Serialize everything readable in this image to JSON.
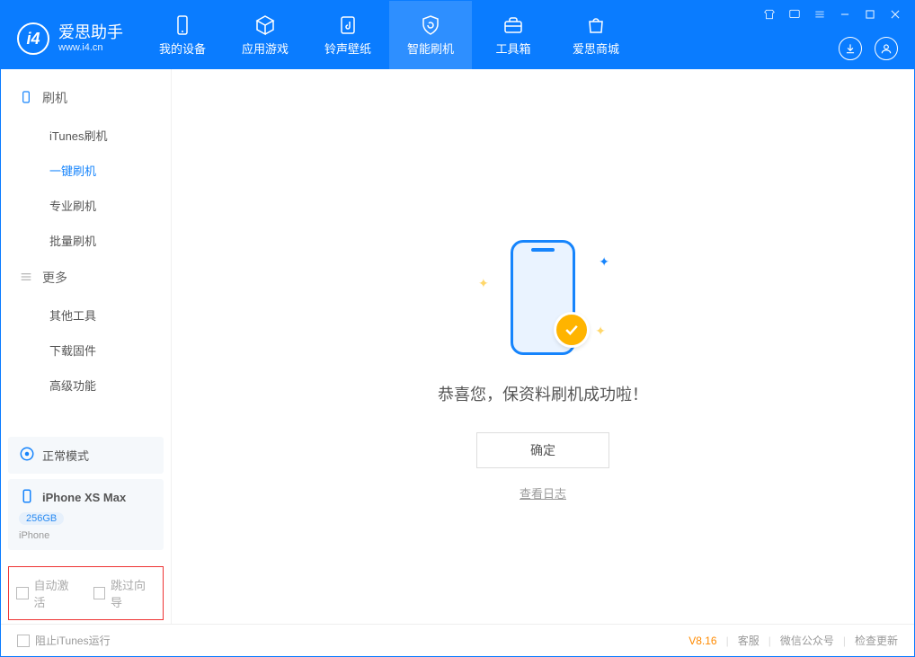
{
  "logo": {
    "title": "爱思助手",
    "subtitle": "www.i4.cn"
  },
  "nav": {
    "device": "我的设备",
    "apps": "应用游戏",
    "ringtones": "铃声壁纸",
    "flash": "智能刷机",
    "tools": "工具箱",
    "store": "爱思商城"
  },
  "sidebar": {
    "section_flash": "刷机",
    "items": {
      "itunes": "iTunes刷机",
      "oneclick": "一键刷机",
      "pro": "专业刷机",
      "batch": "批量刷机"
    },
    "section_more": "更多",
    "more_items": {
      "other_tools": "其他工具",
      "download_fw": "下载固件",
      "advanced": "高级功能"
    },
    "mode": {
      "label": "正常模式"
    },
    "device": {
      "name": "iPhone XS Max",
      "capacity": "256GB",
      "type": "iPhone"
    },
    "options": {
      "auto_activate": "自动激活",
      "skip_guide": "跳过向导"
    }
  },
  "content": {
    "message": "恭喜您，保资料刷机成功啦！",
    "confirm": "确定",
    "view_log": "查看日志"
  },
  "statusbar": {
    "stop_itunes": "阻止iTunes运行",
    "version": "V8.16",
    "support": "客服",
    "wechat": "微信公众号",
    "check_update": "检查更新"
  }
}
